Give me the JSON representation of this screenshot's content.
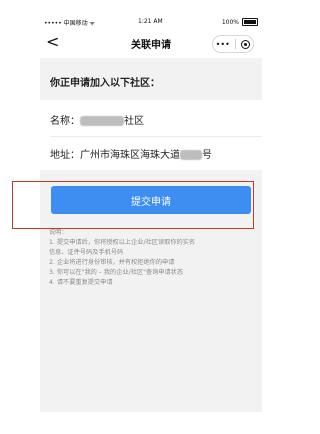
{
  "status_bar": {
    "carrier": "••••• 中国移动 ᯤ",
    "time": "1:21 AM",
    "battery": "100%"
  },
  "nav": {
    "back_symbol": "<",
    "title": "关联申请",
    "more_symbol": "•••"
  },
  "form": {
    "intro": "你正申请加入以下社区：",
    "name_label": "名称：",
    "name_suffix": "社区",
    "address_label": "地址：",
    "address_value": "广州市海珠区海珠大道",
    "address_suffix": "号"
  },
  "submit_label": "提交申请",
  "notes": {
    "heading": "说明：",
    "lines": [
      "1. 提交申请后，你将授权以上企业/社区读取你的实名",
      "信息、证件号码及手机号码",
      "2. 企业将进行身份审核，并有权拒绝你的申请",
      "3. 你可以在\"我的 – 我的企业/社区\"查询申请状态",
      "4. 请不要重复提交申请"
    ]
  },
  "colors": {
    "primary_button": "#3d8ef0",
    "highlight_border": "#c0392b",
    "page_background": "#f2f2f2"
  }
}
